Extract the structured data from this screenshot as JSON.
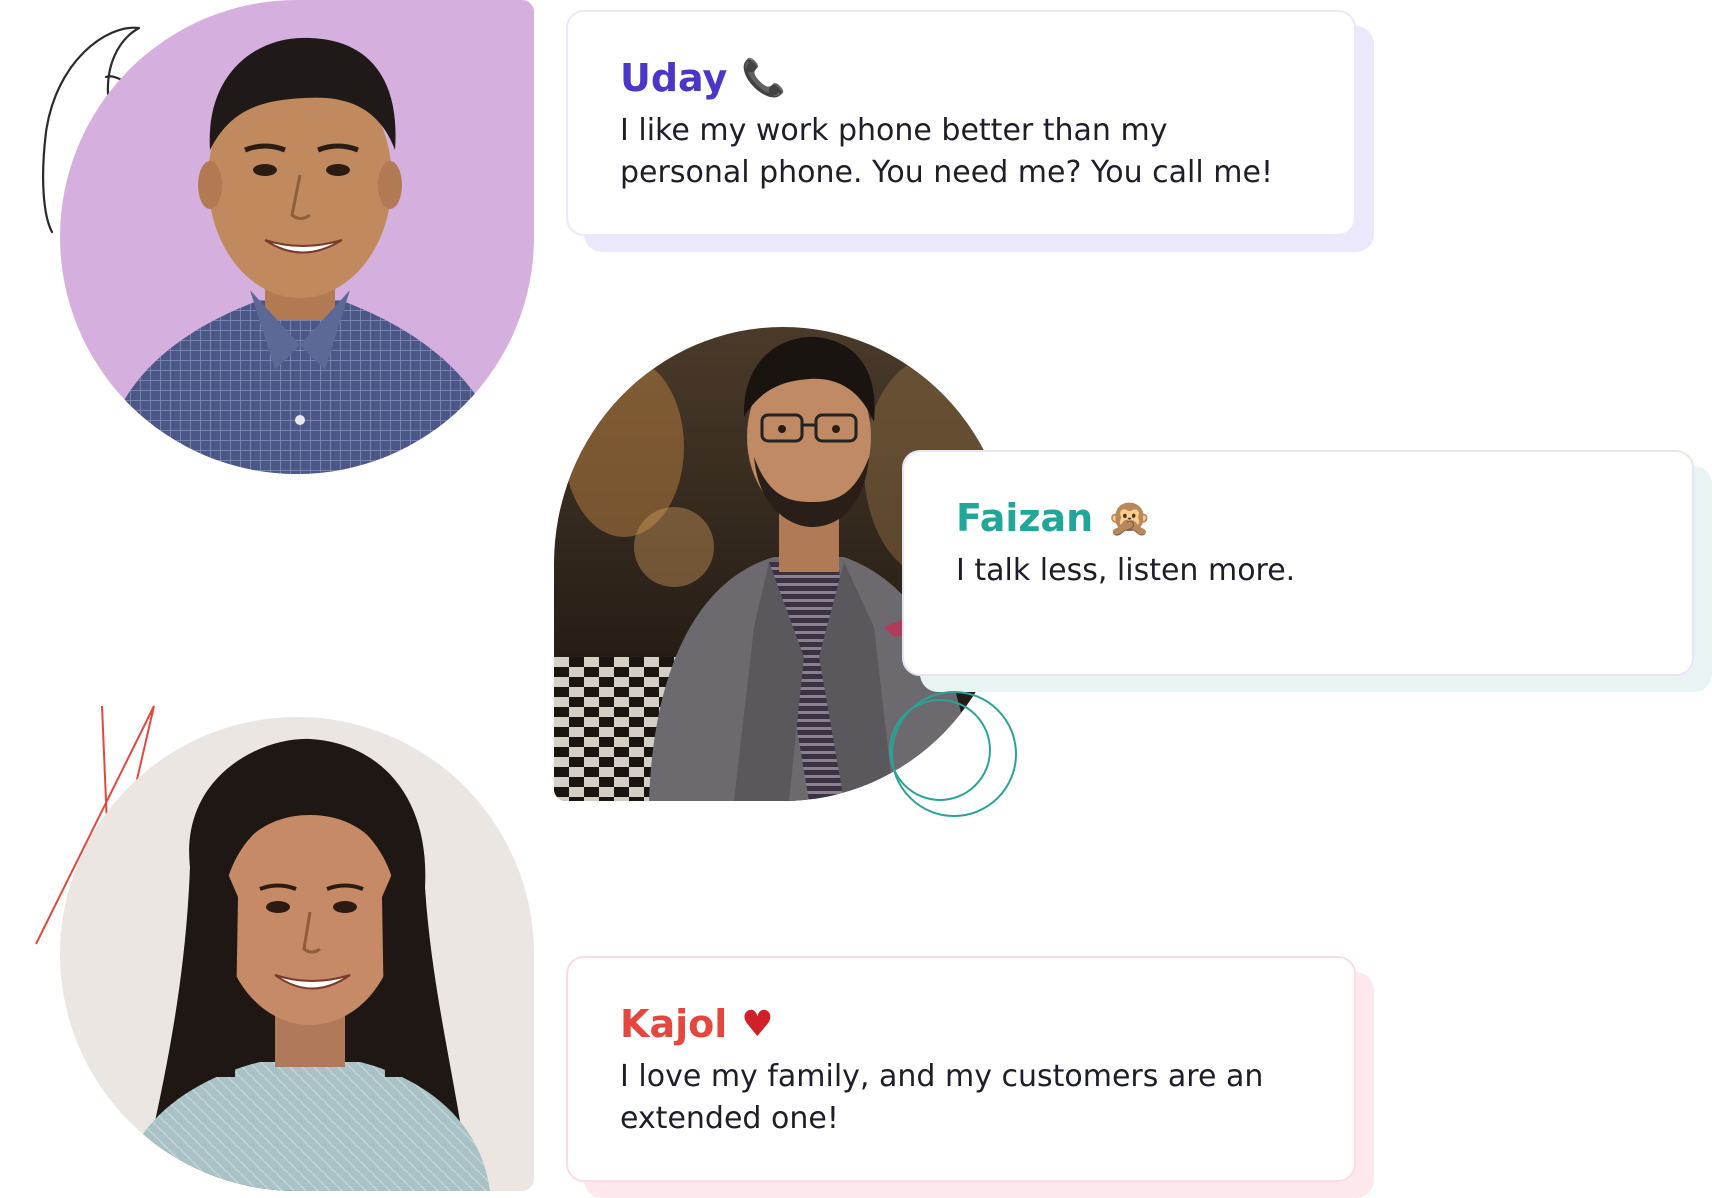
{
  "colors": {
    "uday_accent": "#4a36c8",
    "faizan_accent": "#20a79a",
    "kajol_accent": "#e5473e",
    "uday_photo_bg": "#d5b0df",
    "kajol_photo_bg": "#ece6e2"
  },
  "testimonials": [
    {
      "name": "Uday",
      "emoji": "📞",
      "icon": "telephone-icon",
      "quote": "I like my work phone better than my personal phone. You need me? You call me!"
    },
    {
      "name": "Faizan",
      "emoji": "🙊",
      "icon": "speak-no-evil-monkey-icon",
      "quote": "I talk less, listen more."
    },
    {
      "name": "Kajol",
      "emoji": "♥",
      "icon": "heart-icon",
      "quote": "I love my family, and my customers are an extended one!"
    }
  ]
}
